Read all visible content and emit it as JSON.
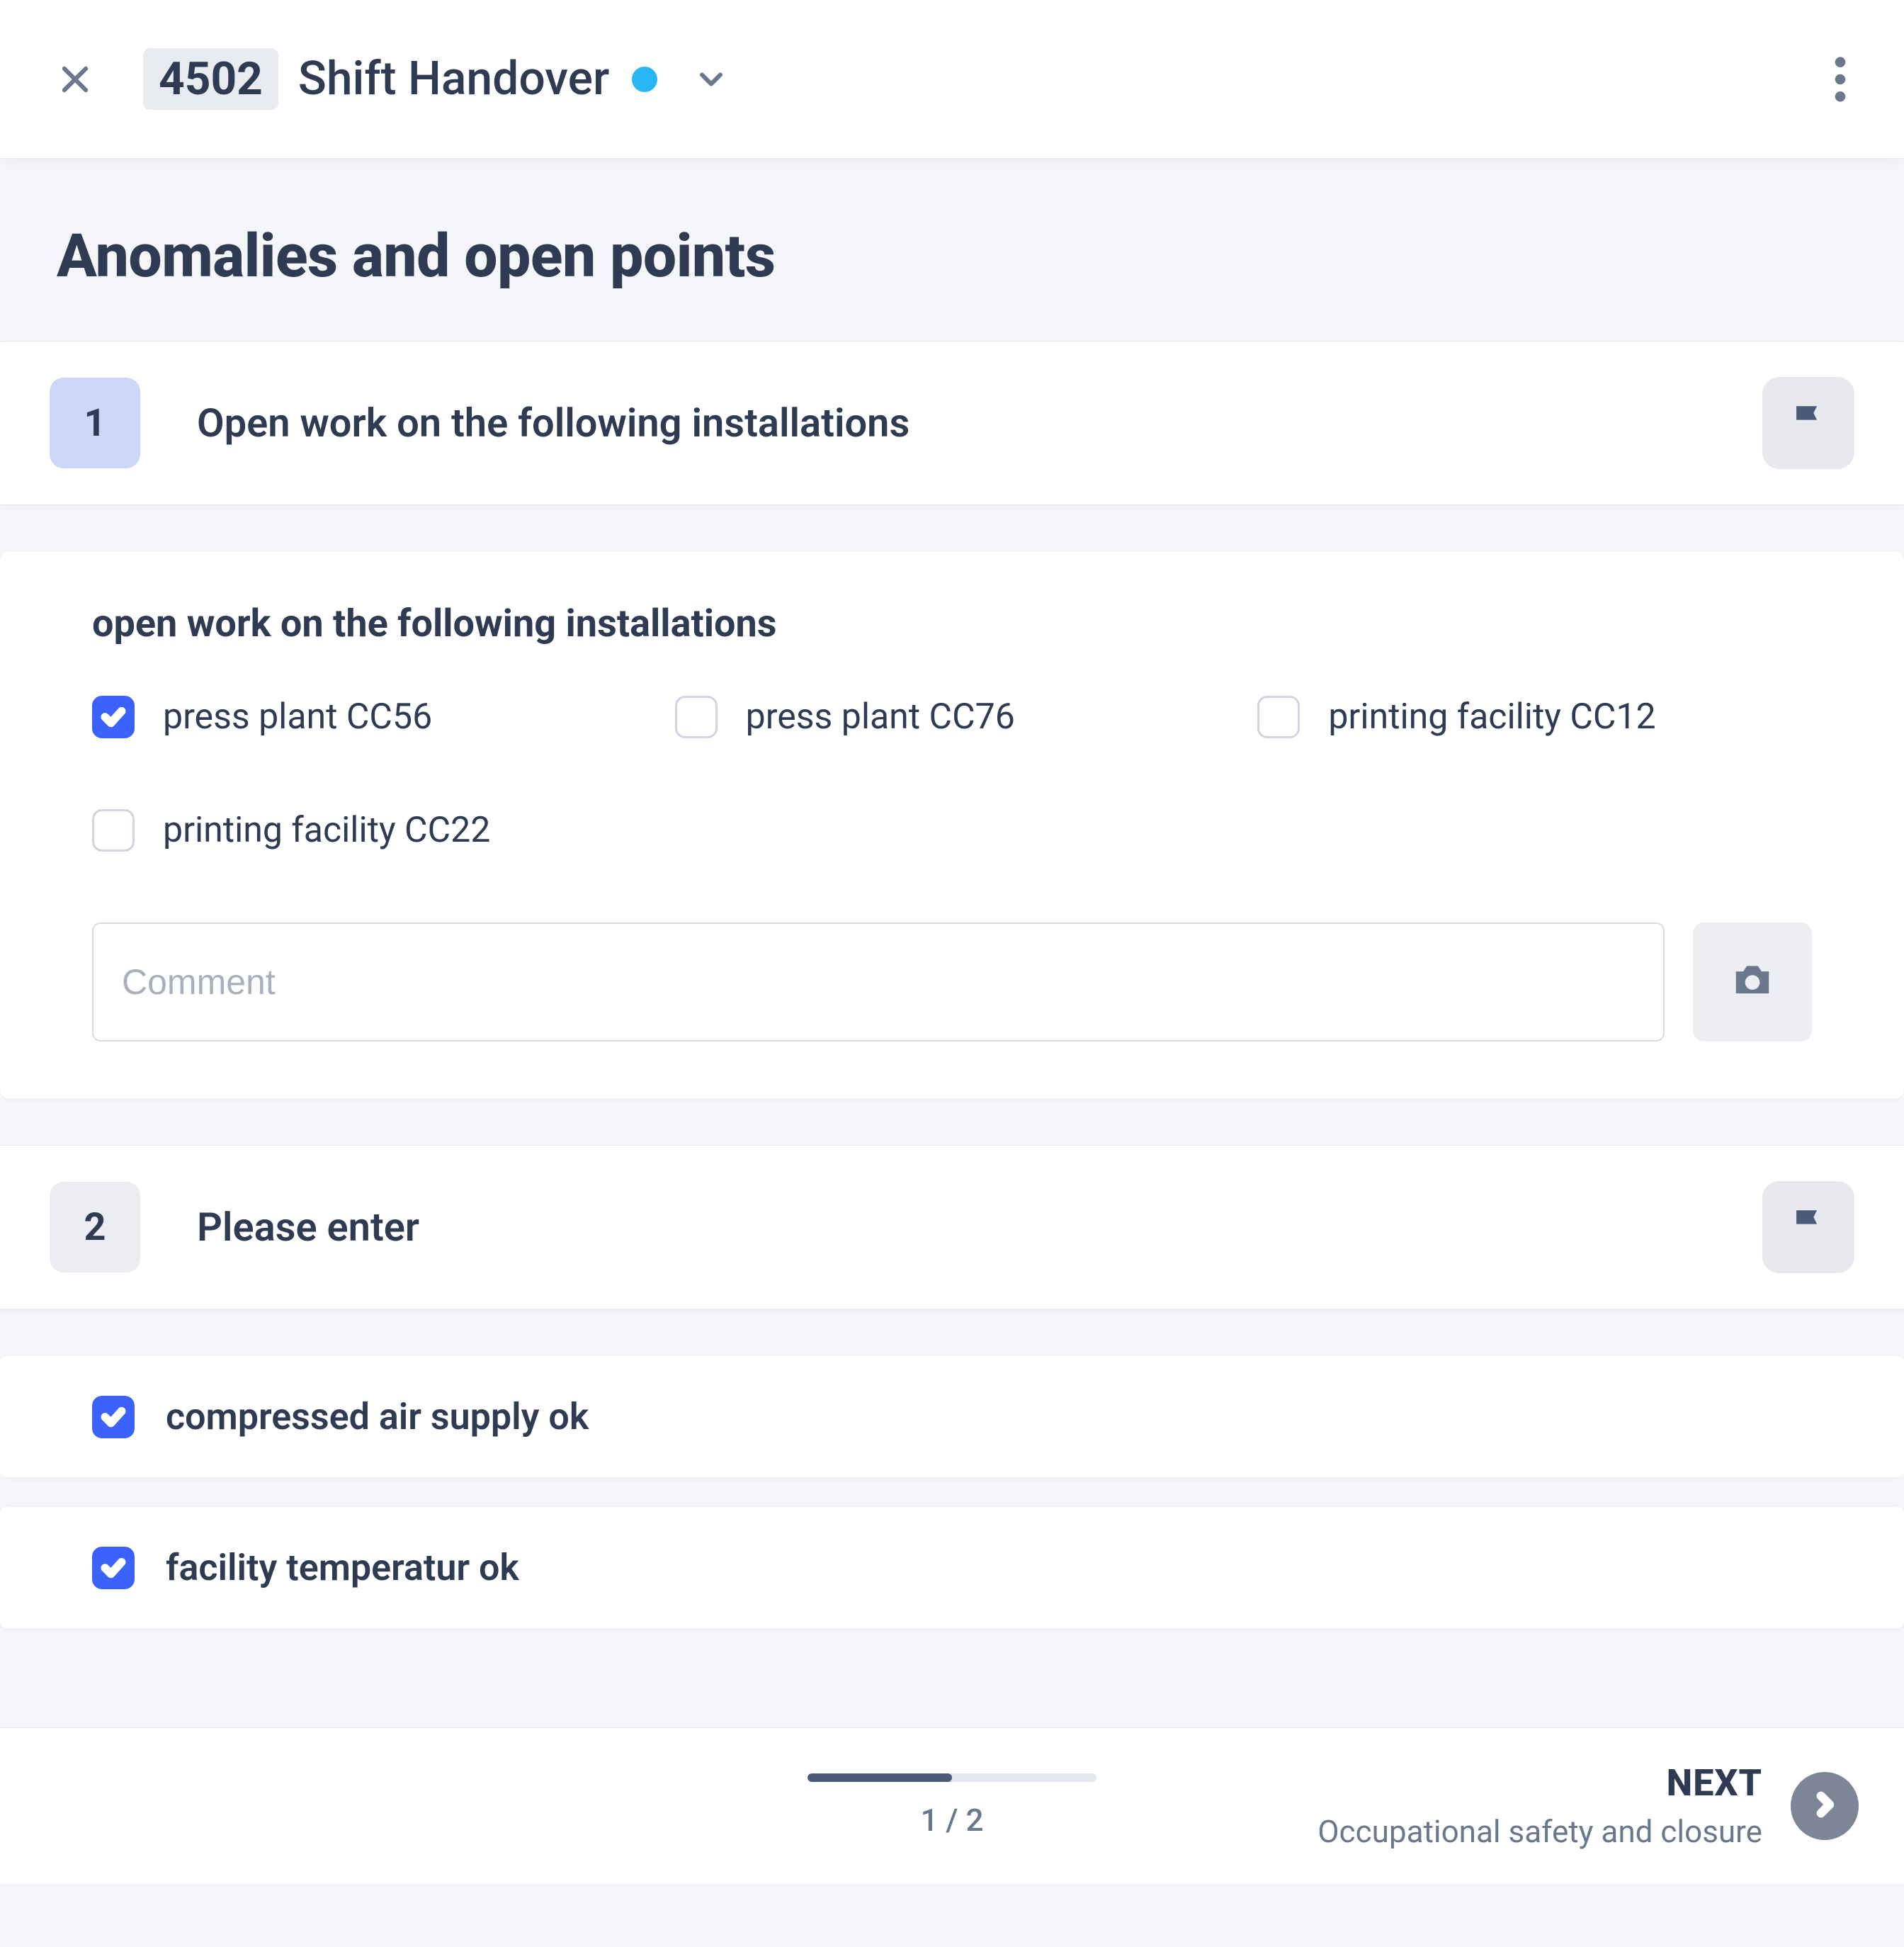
{
  "header": {
    "id_badge": "4502",
    "title": "Shift Handover"
  },
  "section": {
    "title": "Anomalies and open points"
  },
  "q1": {
    "number": "1",
    "title": "Open work on the following installations",
    "subtitle": "open work on the following installations",
    "options": {
      "o0": "press plant CC56",
      "o1": "press plant CC76",
      "o2": "printing facility CC12",
      "o3": "printing facility CC22"
    },
    "comment_placeholder": "Comment"
  },
  "q2": {
    "number": "2",
    "title": "Please enter",
    "items": {
      "i0": "compressed air supply ok",
      "i1": "facility temperatur ok"
    }
  },
  "footer": {
    "progress_text": "1 / 2",
    "next_label": "NEXT",
    "next_sub": "Occupational safety and closure"
  }
}
